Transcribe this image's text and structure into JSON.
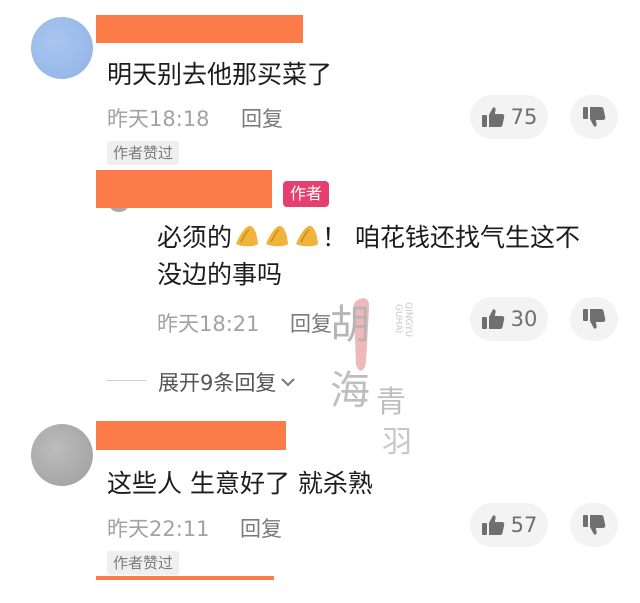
{
  "comments": [
    {
      "text": "明天别去他那买菜了",
      "time": "昨天18:18",
      "reply_label": "回复",
      "likes": "75",
      "liked_by_author": "作者赞过"
    },
    {
      "is_author": true,
      "author_badge": "作者",
      "text_line1_prefix": "必须的",
      "text_line1_suffix": "！ 咱花钱还找气生这不",
      "text_line2": "没边的事吗",
      "emoji": "peanut-emoji",
      "time": "昨天18:21",
      "reply_label": "回复",
      "likes": "30"
    },
    {
      "text": "这些人 生意好了 就杀熟",
      "time": "昨天22:11",
      "reply_label": "回复",
      "likes": "57",
      "liked_by_author": "作者赞过"
    }
  ],
  "expand_replies": "展开9条回复",
  "watermark": {
    "chars": [
      "胡",
      "海",
      "青",
      "羽"
    ],
    "vertical_latin_1": "QINGYU",
    "vertical_latin_2": "GUHAI"
  },
  "colors": {
    "redaction": "#fb7c48",
    "author_badge": "#e54070",
    "muted_text": "#a2a2a2",
    "pill_bg": "#f3f3f3"
  },
  "icons": [
    "thumbs-up-icon",
    "thumbs-down-icon",
    "chevron-down-icon"
  ]
}
